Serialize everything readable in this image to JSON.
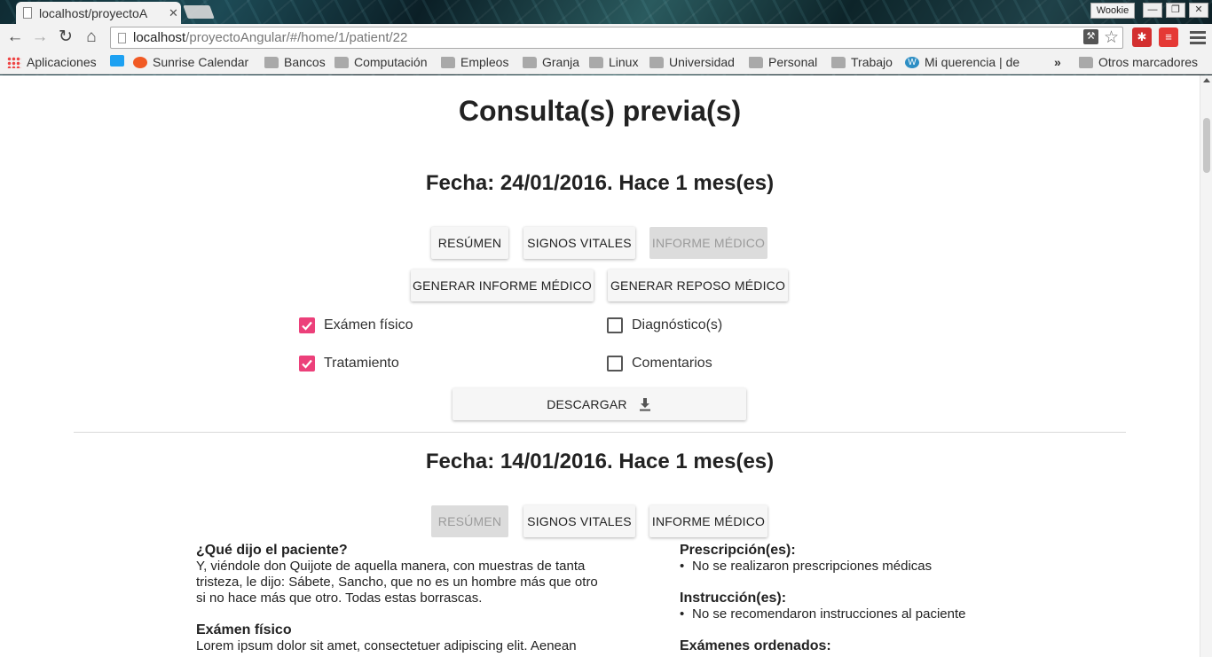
{
  "browser": {
    "tab_title": "localhost/proyectoA",
    "tab_close": "✕",
    "profile_name": "Wookie",
    "window_buttons": {
      "minimize": "—",
      "restore": "❐",
      "close": "✕"
    },
    "url_host": "localhost",
    "url_path": "/proyectoAngular/#/home/1/patient/22",
    "bookmarks": [
      {
        "label": "Aplicaciones",
        "icon": "apps-icon"
      },
      {
        "label": "",
        "icon": "twitter-icon"
      },
      {
        "label": "Sunrise Calendar",
        "icon": "sunrise-icon"
      },
      {
        "label": "Bancos",
        "icon": "folder-icon"
      },
      {
        "label": "Computación",
        "icon": "folder-icon"
      },
      {
        "label": "Empleos",
        "icon": "folder-icon"
      },
      {
        "label": "Granja",
        "icon": "folder-icon"
      },
      {
        "label": "Linux",
        "icon": "folder-icon"
      },
      {
        "label": "Universidad",
        "icon": "folder-icon"
      },
      {
        "label": "Personal",
        "icon": "folder-icon"
      },
      {
        "label": "Trabajo",
        "icon": "folder-icon"
      },
      {
        "label": "Mi querencia | de",
        "icon": "wordpress-icon"
      }
    ],
    "bookmarks_overflow": "»",
    "other_bookmarks": "Otros marcadores"
  },
  "page": {
    "title": "Consulta(s) previa(s)",
    "consult_1": {
      "date": "Fecha: 24/01/2016. Hace 1 mes(es)",
      "tabs": {
        "summary": "RESÚMEN",
        "vitals": "SIGNOS VITALES",
        "report": "INFORME MÉDICO"
      },
      "actions": {
        "generate_report": "GENERAR INFORME MÉDICO",
        "generate_rest": "GENERAR REPOSO MÉDICO"
      },
      "options": {
        "physical_exam": {
          "label": "Exámen físico",
          "checked": true
        },
        "diagnosis": {
          "label": "Diagnóstico(s)",
          "checked": false
        },
        "treatment": {
          "label": "Tratamiento",
          "checked": true
        },
        "comments": {
          "label": "Comentarios",
          "checked": false
        }
      },
      "download": "DESCARGAR"
    },
    "consult_2": {
      "date": "Fecha: 14/01/2016. Hace 1 mes(es)",
      "tabs": {
        "summary": "RESÚMEN",
        "vitals": "SIGNOS VITALES",
        "report": "INFORME MÉDICO"
      },
      "patient_said_label": "¿Qué dijo el paciente?",
      "patient_said": "Y, viéndole don Quijote de aquella manera, con muestras de tanta tristeza, le dijo: Sábete, Sancho, que no es un hombre más que otro si no hace más que otro. Todas estas borrascas.",
      "physical_exam_label": "Exámen físico",
      "physical_exam": "Lorem ipsum dolor sit amet, consectetuer adipiscing elit. Aenean",
      "prescriptions_label": "Prescripción(es):",
      "prescriptions": [
        "No se realizaron prescripciones médicas"
      ],
      "instructions_label": "Instrucción(es):",
      "instructions": [
        "No se recomendaron instrucciones al paciente"
      ],
      "exams_label": "Exámenes ordenados:"
    }
  },
  "colors": {
    "accent_pink": "#ec407a"
  }
}
